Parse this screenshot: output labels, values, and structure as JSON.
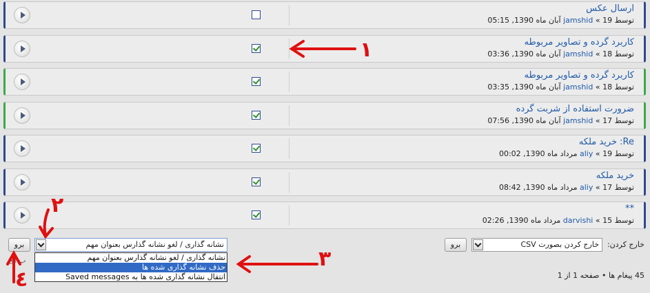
{
  "messages": [
    {
      "title": "ارسال عکس",
      "meta_prefix": "توسط",
      "user": "jamshid",
      "date": "« 19 آبان ماه 1390, 05:15",
      "checked": false,
      "border": "blue"
    },
    {
      "title": "کاربرد گرده و تصاویر مربوطه",
      "meta_prefix": "توسط",
      "user": "jamshid",
      "date": "« 18 آبان ماه 1390, 03:36",
      "checked": true,
      "border": "blue"
    },
    {
      "title": "کاربرد گرده و تصاویر مربوطه",
      "meta_prefix": "توسط",
      "user": "jamshid",
      "date": "« 18 آبان ماه 1390, 03:35",
      "checked": true,
      "border": "green"
    },
    {
      "title": "ضرورت استفاده از شربت گرده",
      "meta_prefix": "توسط",
      "user": "jamshid",
      "date": "« 17 آبان ماه 1390, 07:56",
      "checked": true,
      "border": "green"
    },
    {
      "title": "Re: خرید ملکه",
      "meta_prefix": "توسط",
      "user": "aliy",
      "date": "« 19 مرداد ماه 1390, 00:02",
      "checked": true,
      "border": "blue"
    },
    {
      "title": "خرید ملکه",
      "meta_prefix": "توسط",
      "user": "aliy",
      "date": "« 17 مرداد ماه 1390, 08:42",
      "checked": true,
      "border": "blue"
    },
    {
      "title": "**",
      "meta_prefix": "توسط",
      "user": "darvishi",
      "date": "« 15 مرداد ماه 1390, 02:26",
      "checked": true,
      "border": "blue"
    }
  ],
  "footer": {
    "go_label_left": "برو",
    "action_select_value": "نشانه گذاری / لغو نشانه گذارس بعنوان مهم",
    "dropdown_options": [
      "نشانه گذاری / لغو نشانه گذارس بعنوان مهم",
      "حذف نشانه گذاری شده ها",
      "انتقال نشانه گذاری شده ها به Saved messages"
    ],
    "selected_option_index": 1,
    "export_label": "خارج کردن:",
    "export_select_value": "خارج کردن بصورت CSV",
    "go_label_right": "برو",
    "pagination": "45 پیغام ها • صفحه 1 از 1",
    "partial_text": "ب ای"
  },
  "annotations": {
    "n1": "١",
    "n2": "٢",
    "n3": "٣",
    "n4": "٤",
    "color": "#e01010"
  }
}
